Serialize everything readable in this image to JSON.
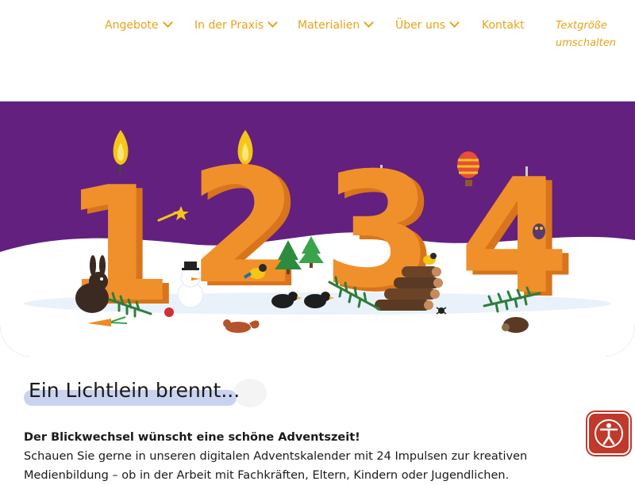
{
  "nav": {
    "items": [
      {
        "label": "Angebote",
        "has_dropdown": true
      },
      {
        "label": "In der Praxis",
        "has_dropdown": true
      },
      {
        "label": "Materialien",
        "has_dropdown": true
      },
      {
        "label": "Über uns",
        "has_dropdown": true
      },
      {
        "label": "Kontakt",
        "has_dropdown": false
      }
    ],
    "textsize_line1": "Textgröße",
    "textsize_line2": "umschalten"
  },
  "hero": {
    "numbers": [
      "1",
      "2",
      "3",
      "4"
    ],
    "background_color": "#63207e",
    "number_color": "#f0902a"
  },
  "content": {
    "heading": "Ein Lichtlein brennt...",
    "intro_bold": "Der Blickwechsel wünscht eine schöne Adventszeit!",
    "paragraph_line1": "Schauen Sie gerne in unseren digitalen Adventskalender mit 24 Impulsen zur kreativen",
    "paragraph_line2": "Medienbildung – ob in der Arbeit mit Fachkräften, Eltern, Kindern oder Jugendlichen."
  },
  "accessibility_button": {
    "icon": "accessibility-person-icon"
  },
  "colors": {
    "accent": "#e8a317",
    "brand_purple": "#63207e",
    "orange": "#f0902a",
    "button_red": "#c0392b"
  }
}
